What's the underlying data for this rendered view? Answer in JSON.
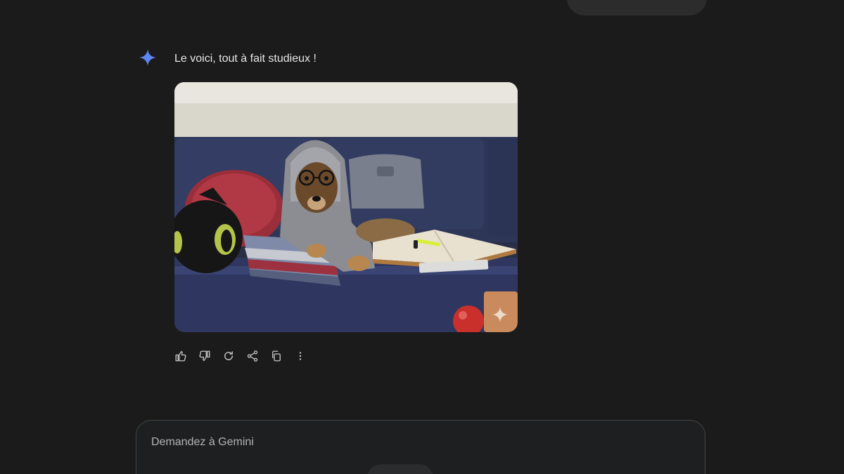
{
  "response": {
    "text": "Le voici, tout à fait studieux !",
    "assistant_icon": "gemini-sparkle-icon",
    "image": {
      "description": "generated-image",
      "watermark_icon": "sparkle-icon"
    }
  },
  "actions": [
    {
      "name": "thumbs-up-icon"
    },
    {
      "name": "thumbs-down-icon"
    },
    {
      "name": "regenerate-icon"
    },
    {
      "name": "share-icon"
    },
    {
      "name": "copy-icon"
    },
    {
      "name": "more-vert-icon"
    }
  ],
  "prompt": {
    "placeholder": "Demandez à Gemini"
  },
  "colors": {
    "background": "#1b1b1b",
    "accent": "#4c8df6",
    "icon": "#c4c7c5"
  }
}
